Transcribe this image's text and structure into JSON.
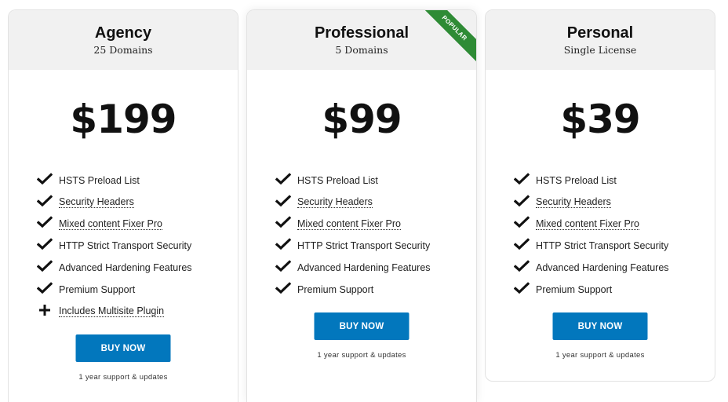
{
  "plans": [
    {
      "name": "Agency",
      "subtitle": "25 Domains",
      "price": "$199",
      "features": [
        {
          "icon": "check-icon",
          "label": "HSTS Preload List",
          "tooltip": false
        },
        {
          "icon": "check-icon",
          "label": "Security Headers",
          "tooltip": true
        },
        {
          "icon": "check-icon",
          "label": "Mixed content Fixer Pro",
          "tooltip": true
        },
        {
          "icon": "check-icon",
          "label": "HTTP Strict Transport Security",
          "tooltip": false
        },
        {
          "icon": "check-icon",
          "label": "Advanced Hardening Features",
          "tooltip": false
        },
        {
          "icon": "check-icon",
          "label": "Premium Support",
          "tooltip": false
        },
        {
          "icon": "plus-icon",
          "label": "Includes Multisite Plugin",
          "tooltip": true
        }
      ],
      "button_label": "BUY NOW",
      "note": "1 year support & updates"
    },
    {
      "name": "Professional",
      "subtitle": "5 Domains",
      "price": "$99",
      "badge": "POPULAR",
      "features": [
        {
          "icon": "check-icon",
          "label": "HSTS Preload List",
          "tooltip": false
        },
        {
          "icon": "check-icon",
          "label": "Security Headers",
          "tooltip": true
        },
        {
          "icon": "check-icon",
          "label": "Mixed content Fixer Pro",
          "tooltip": true
        },
        {
          "icon": "check-icon",
          "label": "HTTP Strict Transport Security",
          "tooltip": false
        },
        {
          "icon": "check-icon",
          "label": "Advanced Hardening Features",
          "tooltip": false
        },
        {
          "icon": "check-icon",
          "label": "Premium Support",
          "tooltip": false
        }
      ],
      "button_label": "BUY NOW",
      "note": "1 year support & updates"
    },
    {
      "name": "Personal",
      "subtitle": "Single License",
      "price": "$39",
      "features": [
        {
          "icon": "check-icon",
          "label": "HSTS Preload List",
          "tooltip": false
        },
        {
          "icon": "check-icon",
          "label": "Security Headers",
          "tooltip": true
        },
        {
          "icon": "check-icon",
          "label": "Mixed content Fixer Pro",
          "tooltip": true
        },
        {
          "icon": "check-icon",
          "label": "HTTP Strict Transport Security",
          "tooltip": false
        },
        {
          "icon": "check-icon",
          "label": "Advanced Hardening Features",
          "tooltip": false
        },
        {
          "icon": "check-icon",
          "label": "Premium Support",
          "tooltip": false
        }
      ],
      "button_label": "BUY NOW",
      "note": "1 year support & updates"
    }
  ],
  "colors": {
    "button": "#0277bd",
    "badge": "#2e8b35",
    "header_bg": "#f1f1f1"
  }
}
